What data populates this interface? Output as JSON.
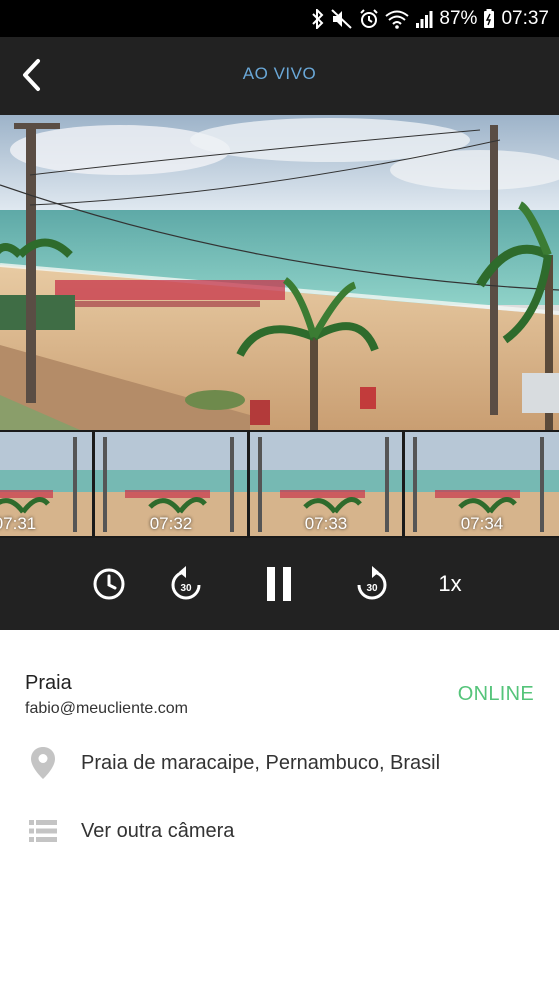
{
  "status_bar": {
    "battery": "87%",
    "time": "07:37",
    "icons": [
      "bluetooth-icon",
      "mute-icon",
      "alarm-icon",
      "wifi-icon",
      "signal-icon",
      "battery-icon"
    ]
  },
  "app_bar": {
    "title": "AO VIVO",
    "back_icon": "chevron-left-icon"
  },
  "thumbnails": [
    {
      "time": "07:31"
    },
    {
      "time": "07:32"
    },
    {
      "time": "07:33"
    },
    {
      "time": "07:34"
    }
  ],
  "controls": {
    "history_icon": "clock-icon",
    "rewind_icon": "replay-30-icon",
    "rewind_label": "30",
    "pause_icon": "pause-icon",
    "forward_icon": "forward-30-icon",
    "forward_label": "30",
    "speed": "1x"
  },
  "camera": {
    "name": "Praia",
    "email": "fabio@meucliente.com",
    "status": "ONLINE",
    "location": "Praia de maracaipe, Pernambuco, Brasil",
    "other_camera": "Ver outra câmera"
  },
  "colors": {
    "status_bar": "#000000",
    "app_bar": "#222222",
    "title": "#6aa8d8",
    "online": "#55c47a",
    "icon_gray": "#c4c4c4"
  }
}
